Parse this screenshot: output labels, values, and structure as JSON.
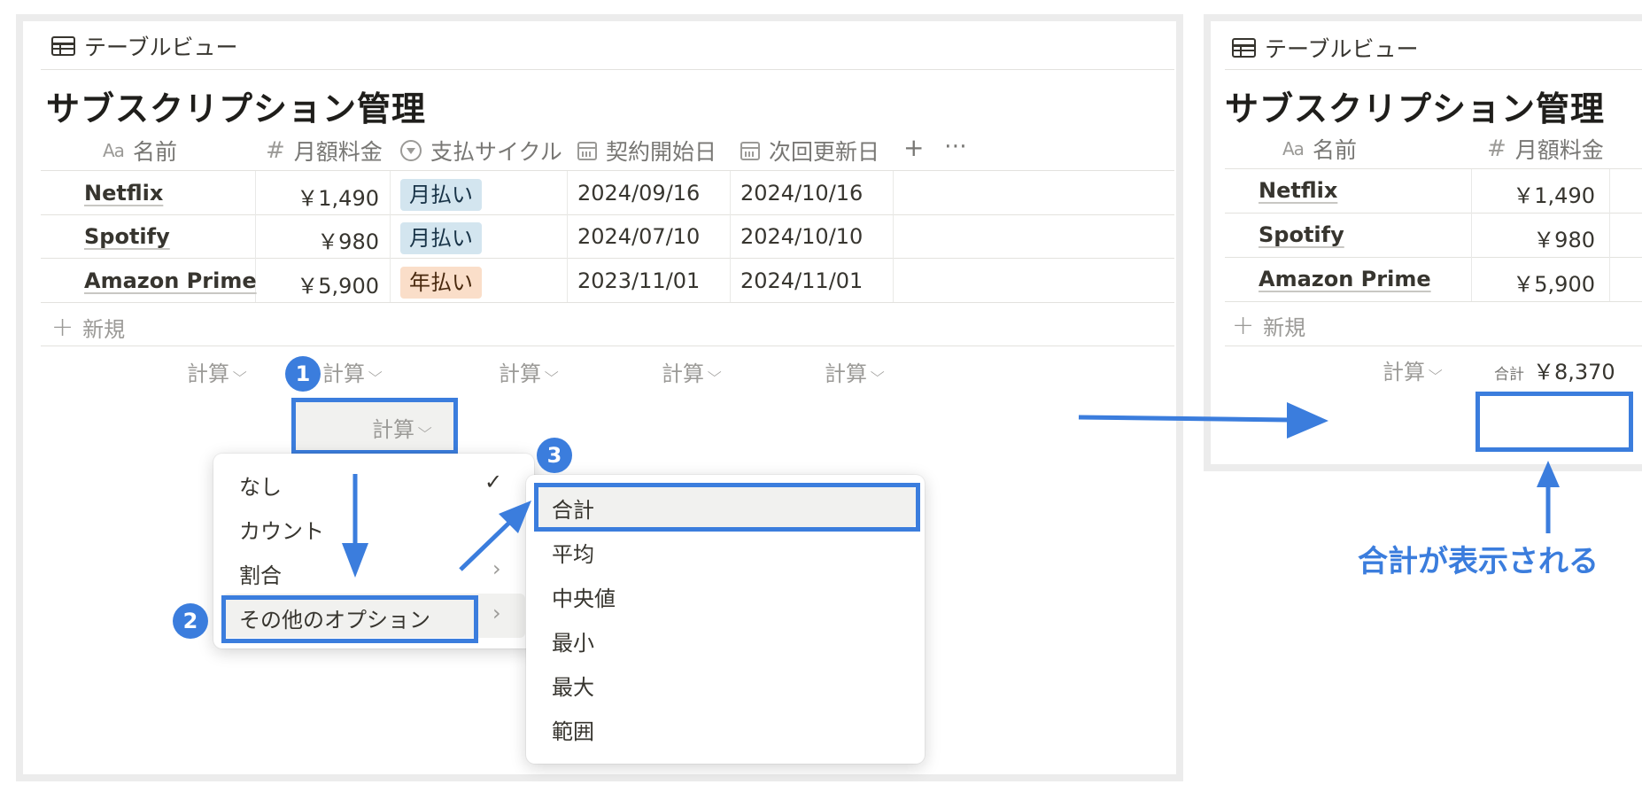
{
  "view_tab_label": "テーブルビュー",
  "page_title": "サブスクリプション管理",
  "columns": [
    {
      "label": "名前",
      "icon": "text-aa-icon"
    },
    {
      "label": "月額料金",
      "icon": "number-hash-icon"
    },
    {
      "label": "支払サイクル",
      "icon": "select-icon"
    },
    {
      "label": "契約開始日",
      "icon": "calendar-icon"
    },
    {
      "label": "次回更新日",
      "icon": "calendar-icon"
    }
  ],
  "text_icon_glyph": "Aa",
  "number_icon_glyph": "#",
  "add_column_glyph": "+",
  "more_glyph": "⋯",
  "rows": [
    {
      "name": "Netflix",
      "price": "￥1,490",
      "cycle": "月払い",
      "cycle_color": "blue",
      "start": "2024/09/16",
      "next": "2024/10/16"
    },
    {
      "name": "Spotify",
      "price": "￥980",
      "cycle": "月払い",
      "cycle_color": "blue",
      "start": "2024/07/10",
      "next": "2024/10/10"
    },
    {
      "name": "Amazon Prime",
      "price": "￥5,900",
      "cycle": "年払い",
      "cycle_color": "orange",
      "start": "2023/11/01",
      "next": "2024/11/01"
    }
  ],
  "new_row_label": "新規",
  "plus_glyph": "+",
  "calc_label": "計算",
  "chevron_glyph": "⌵",
  "calc_menu": {
    "items": [
      "なし",
      "カウント",
      "割合",
      "その他のオプション"
    ],
    "checked_glyph": "✓",
    "submenu_arrow": "›"
  },
  "more_options_menu": {
    "items": [
      "合計",
      "平均",
      "中央値",
      "最小",
      "最大",
      "範囲"
    ]
  },
  "steps": [
    "1",
    "2",
    "3"
  ],
  "result": {
    "prefix": "合計",
    "value": "￥8,370"
  },
  "caption": "合計が表示される",
  "colors": {
    "accent": "#3b7ddd",
    "tag_blue": "#d3e5ef",
    "tag_orange": "#fadec9"
  }
}
